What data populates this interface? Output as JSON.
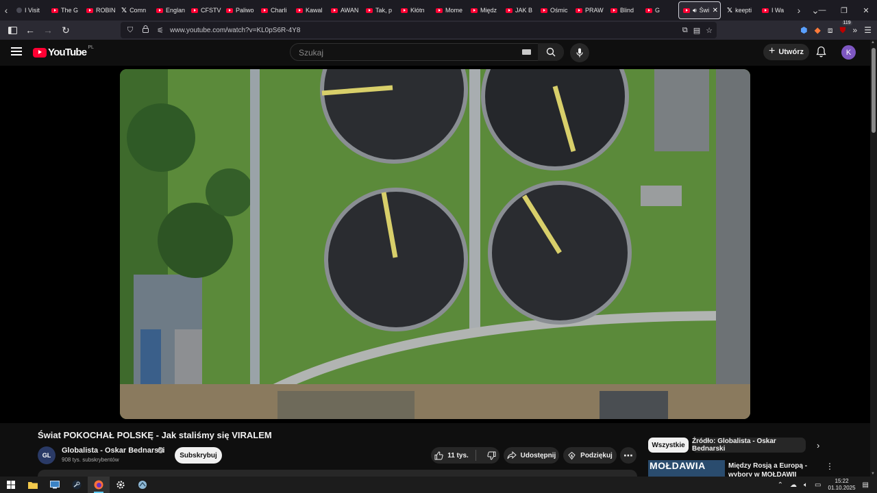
{
  "browser": {
    "tabs": [
      {
        "label": "I Visit",
        "favicon": "generic"
      },
      {
        "label": "The G",
        "favicon": "youtube"
      },
      {
        "label": "ROBIN",
        "favicon": "youtube"
      },
      {
        "label": "Comn",
        "favicon": "x"
      },
      {
        "label": "Englan",
        "favicon": "youtube"
      },
      {
        "label": "CFSTV",
        "favicon": "youtube"
      },
      {
        "label": "Paliwo",
        "favicon": "youtube"
      },
      {
        "label": "Charli",
        "favicon": "youtube"
      },
      {
        "label": "Kawal",
        "favicon": "youtube"
      },
      {
        "label": "AWAN",
        "favicon": "youtube"
      },
      {
        "label": "Tak, p",
        "favicon": "youtube"
      },
      {
        "label": "Kłótn",
        "favicon": "youtube"
      },
      {
        "label": "Mome",
        "favicon": "youtube"
      },
      {
        "label": "Międz",
        "favicon": "youtube"
      },
      {
        "label": "JAK B",
        "favicon": "youtube"
      },
      {
        "label": "Ośmic",
        "favicon": "youtube"
      },
      {
        "label": "PRAW",
        "favicon": "youtube"
      },
      {
        "label": "Blind",
        "favicon": "youtube"
      },
      {
        "label": "G",
        "favicon": "youtube"
      }
    ],
    "active_tab": {
      "label": "Świ",
      "favicon": "youtube"
    },
    "tabs_after": [
      {
        "label": "keepti",
        "favicon": "x"
      },
      {
        "label": "I Wa",
        "favicon": "youtube"
      }
    ],
    "url": "www.youtube.com/watch?v=KL0pS6R-4Y8",
    "extension_badge": "119"
  },
  "youtube": {
    "logo_text": "YouTube",
    "country_code": "PL",
    "search_placeholder": "Szukaj",
    "create_label": "Utwórz",
    "avatar_letter": "K"
  },
  "video": {
    "title": "Świat POKOCHAŁ POLSKĘ - Jak staliśmy się VIRALEM",
    "channel_name": "Globalista - Oskar Bednarski",
    "channel_initials": "GL",
    "subscribers": "908 tys. subskrybentów",
    "subscribe_label": "Subskrybuj",
    "likes": "11 tys.",
    "share_label": "Udostępnij",
    "thanks_label": "Podziękuj"
  },
  "sidebar": {
    "chip_all": "Wszystkie",
    "chip_source": "Źródło: Globalista - Oskar Bednarski",
    "rec_thumb_text": "MOŁDAWIA",
    "rec_title": "Między Rosją a Europą - wybory w MOŁDAWII"
  },
  "taskbar": {
    "time": "15:22",
    "date": "01.10.2025"
  },
  "colors": {
    "accent_red": "#ff0033",
    "background": "#0f0f0f"
  }
}
